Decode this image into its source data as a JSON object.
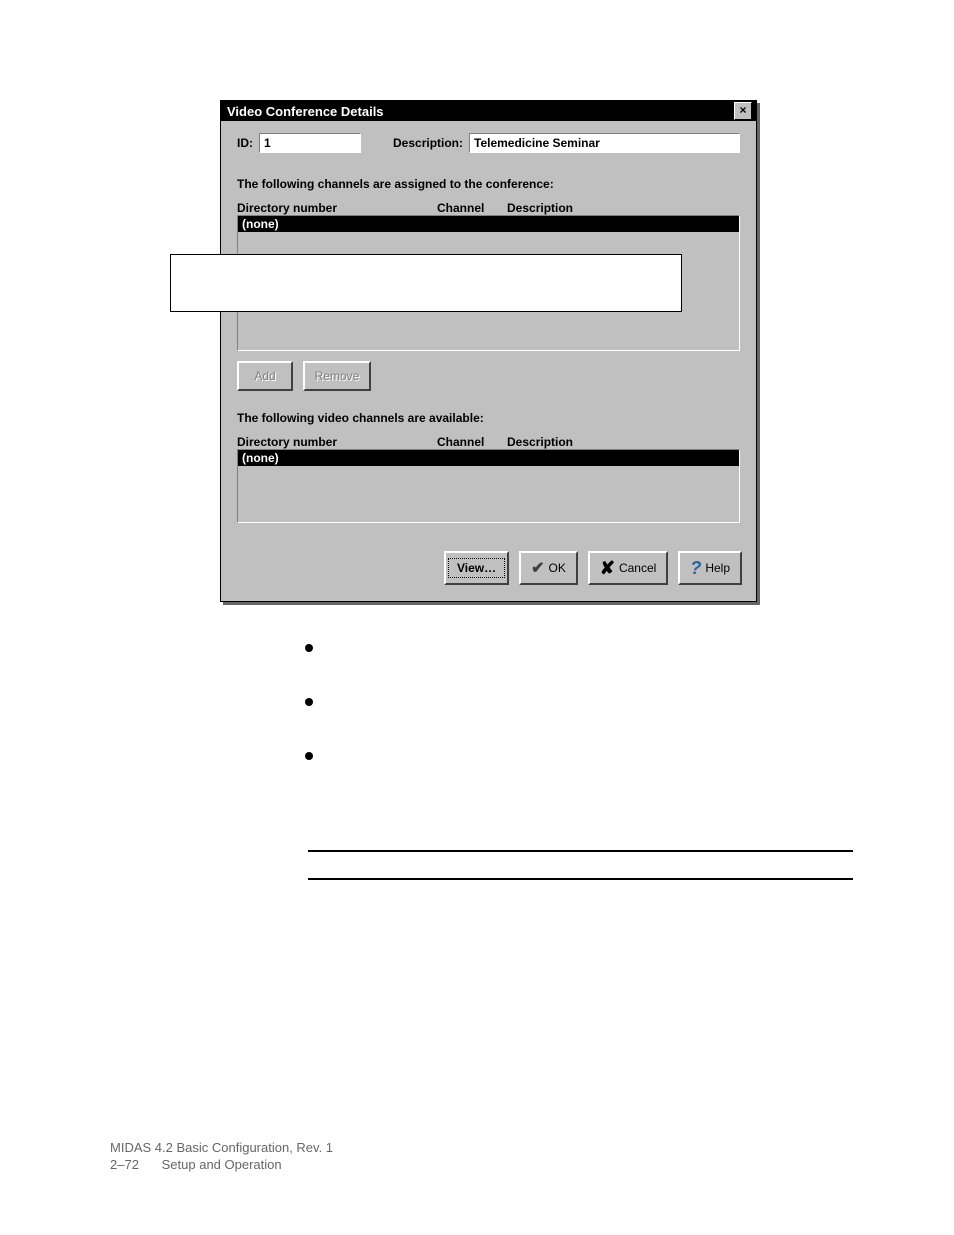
{
  "dialog": {
    "title": "Video Conference Details",
    "id_label": "ID:",
    "id_value": "1",
    "desc_label": "Description:",
    "desc_value": "Telemedicine Seminar",
    "assigned_text": "The following channels are assigned to the conference:",
    "col_dn": "Directory number",
    "col_ch": "Channel",
    "col_de": "Description",
    "none": "(none)",
    "add_label": "Add",
    "remove_label": "Remove",
    "available_text": "The following video channels are available:",
    "view_label": "View…",
    "ok_label": "OK",
    "cancel_label": "Cancel",
    "help_label": "Help"
  },
  "footer": {
    "line1": "MIDAS 4.2 Basic Configuration,  Rev. 1",
    "page": "2–72",
    "section": "Setup and Operation"
  }
}
